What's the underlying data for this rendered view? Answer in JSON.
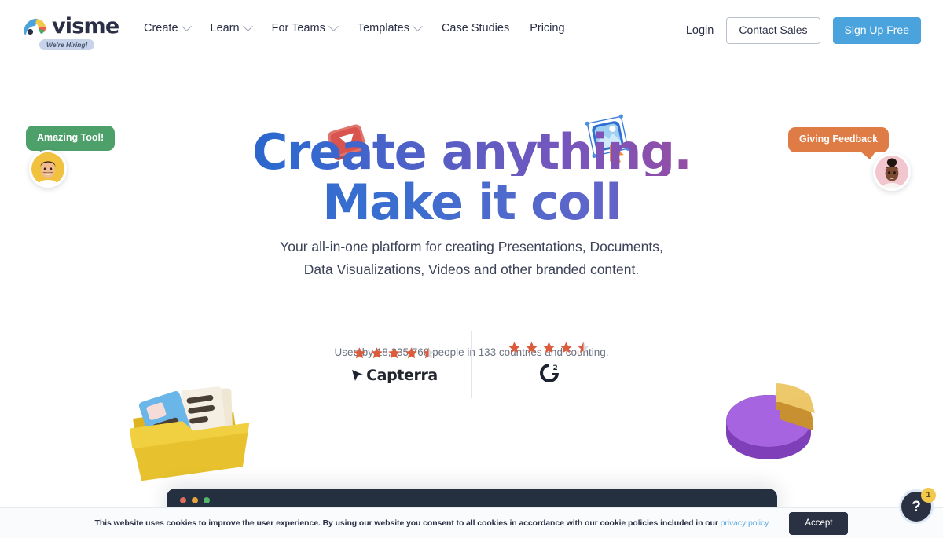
{
  "header": {
    "logo": {
      "wordmark": "visme",
      "icon": "visme-fan-logo",
      "hiring_badge": "We're Hiring!"
    },
    "nav": [
      {
        "label": "Create",
        "has_dropdown": true,
        "key": "create"
      },
      {
        "label": "Learn",
        "has_dropdown": true,
        "key": "learn"
      },
      {
        "label": "For Teams",
        "has_dropdown": true,
        "key": "for-teams"
      },
      {
        "label": "Templates",
        "has_dropdown": true,
        "key": "templates"
      },
      {
        "label": "Case Studies",
        "has_dropdown": false,
        "key": "case-studies"
      },
      {
        "label": "Pricing",
        "has_dropdown": false,
        "key": "pricing"
      }
    ],
    "login_label": "Login",
    "contact_sales_label": "Contact Sales",
    "signup_label": "Sign Up Free"
  },
  "hero": {
    "headline_line1": "Create anything.",
    "headline_line2": "Make it coll",
    "subhead_line1": "Your all-in-one platform for creating Presentations, Documents,",
    "subhead_line2": "Data Visualizations, Videos and other branded content.",
    "used_by": "Used by 18,235,768 people in 133 countries and counting."
  },
  "testimonials": [
    {
      "text": "Amazing Tool!",
      "color": "#4da06a",
      "avatar_bg": "#f0c240",
      "side": "left"
    },
    {
      "text": "Giving Feedback",
      "color": "#df7c45",
      "avatar_bg": "#f2c6cf",
      "side": "right"
    }
  ],
  "ratings": [
    {
      "platform": "Capterra",
      "stars": 4.5,
      "max_stars": 5,
      "logo": "capterra-logo"
    },
    {
      "platform": "G2",
      "stars": 4.5,
      "max_stars": 5,
      "logo": "g2-logo"
    }
  ],
  "decor": [
    {
      "name": "video-play-3d-icon",
      "color": "#d9534f"
    },
    {
      "name": "image-media-3d-icon",
      "color": "#2f7bd4"
    },
    {
      "name": "folder-documents-3d-icon",
      "color": "#e8c13c"
    },
    {
      "name": "pie-chart-3d-icon",
      "color": "#9b59d0"
    }
  ],
  "browser_mock": {
    "dots": [
      "#e06c60",
      "#e8a33d",
      "#53b76a"
    ]
  },
  "cookie_bar": {
    "text_before": "This website uses cookies to improve the user experience. By using our website you consent to all cookies in accordance with our cookie policies included in our ",
    "link_label": "privacy policy.",
    "accept_label": "Accept"
  },
  "help_widget": {
    "glyph": "?",
    "badge_count": "1"
  },
  "colors": {
    "primary_blue": "#4aa3dd",
    "dark_navy": "#2a3142",
    "star_orange": "#dd5b3d",
    "link_blue": "#5aa9e6"
  }
}
